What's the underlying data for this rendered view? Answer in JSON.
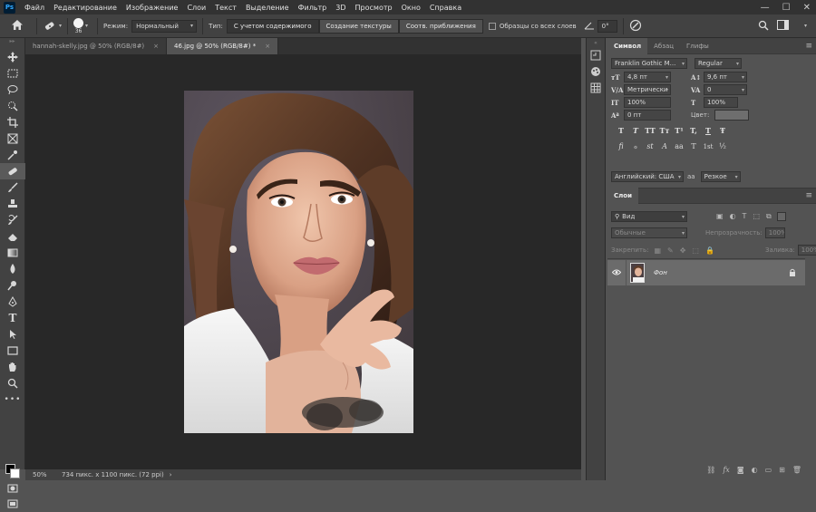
{
  "app": {
    "logo": "Ps"
  },
  "menu": [
    "Файл",
    "Редактирование",
    "Изображение",
    "Слои",
    "Текст",
    "Выделение",
    "Фильтр",
    "3D",
    "Просмотр",
    "Окно",
    "Справка"
  ],
  "window_controls": [
    "—",
    "☐",
    "✕"
  ],
  "options": {
    "brush_size": "36",
    "mode_label": "Режим:",
    "mode_value": "Нормальный",
    "type_label": "Тип:",
    "type_buttons": [
      "С учетом содержимого",
      "Создание текстуры",
      "Соотв. приближения"
    ],
    "sample_all_label": "Образцы со всех слоев",
    "angle_value": "0°"
  },
  "tabs": [
    {
      "label": "hannah-skelly.jpg @ 50% (RGB/8#)",
      "close": "×"
    },
    {
      "label": "46.jpg @ 50% (RGB/8#) *",
      "close": "×"
    }
  ],
  "status": {
    "zoom": "50%",
    "info": "734 пикс. x 1100 пикс. (72 ppi)",
    "nav": "›"
  },
  "character_panel": {
    "tabs": [
      "Символ",
      "Абзац",
      "Глифы"
    ],
    "font_family": "Franklin Gothic M...",
    "font_style": "Regular",
    "font_size": "4,8 пт",
    "leading": "9,6 пт",
    "kerning": "Метрически",
    "tracking": "0",
    "vscale": "100%",
    "hscale": "100%",
    "baseline": "0 пт",
    "color_label": "Цвет:",
    "type_buttons": [
      "T",
      "T",
      "TT",
      "Tт",
      "T¹",
      "T,",
      "T",
      "Ŧ"
    ],
    "ot_buttons": [
      "fi",
      "ℴ",
      "st",
      "A",
      "aa",
      "T",
      "1st",
      "½"
    ],
    "language": "Английский: США",
    "aa_label": "aa",
    "antialias": "Резкое"
  },
  "layers_panel": {
    "title": "Слои",
    "filter_kind": "Вид",
    "blend_mode": "Обычные",
    "opacity_label": "Непрозрачность:",
    "opacity_value": "100%",
    "lock_label": "Закрепить:",
    "fill_label": "Заливка:",
    "fill_value": "100%",
    "layer_name": "Фон"
  }
}
